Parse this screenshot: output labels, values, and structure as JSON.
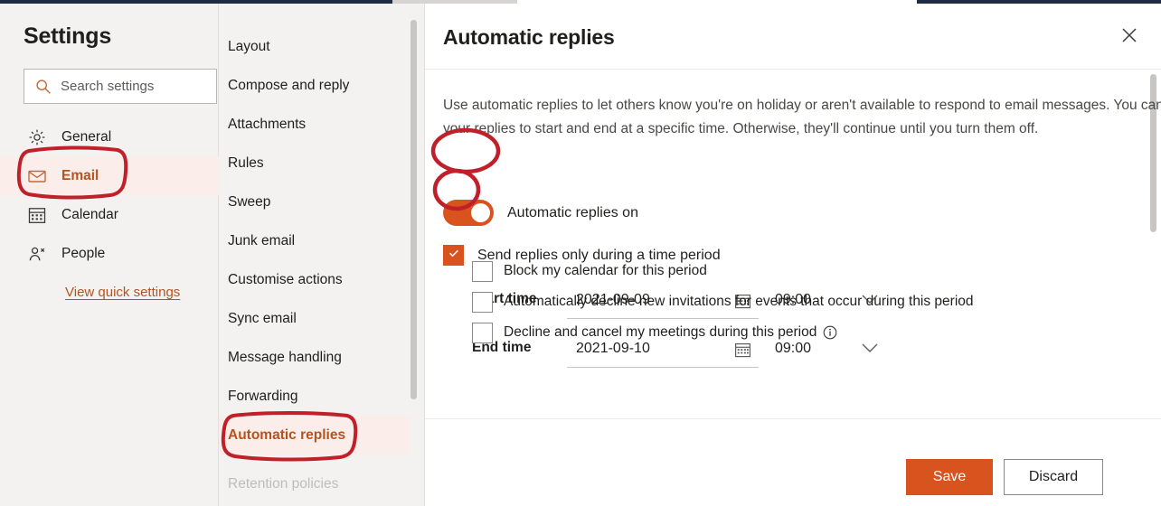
{
  "sidebar": {
    "title": "Settings",
    "search": {
      "placeholder": "Search settings",
      "icon": "search-icon"
    },
    "items": [
      {
        "label": "General",
        "icon": "gear-icon",
        "selected": false
      },
      {
        "label": "Email",
        "icon": "envelope-icon",
        "selected": true
      },
      {
        "label": "Calendar",
        "icon": "calendar-icon",
        "selected": false
      },
      {
        "label": "People",
        "icon": "people-icon",
        "selected": false
      }
    ],
    "quick_link": "View quick settings"
  },
  "subnav": {
    "items": [
      {
        "label": "Layout",
        "selected": false
      },
      {
        "label": "Compose and reply",
        "selected": false
      },
      {
        "label": "Attachments",
        "selected": false
      },
      {
        "label": "Rules",
        "selected": false
      },
      {
        "label": "Sweep",
        "selected": false
      },
      {
        "label": "Junk email",
        "selected": false
      },
      {
        "label": "Customise actions",
        "selected": false
      },
      {
        "label": "Sync email",
        "selected": false
      },
      {
        "label": "Message handling",
        "selected": false
      },
      {
        "label": "Forwarding",
        "selected": false
      },
      {
        "label": "Automatic replies",
        "selected": true
      }
    ],
    "clipped_item": "Retention policies"
  },
  "panel": {
    "title": "Automatic replies",
    "close_icon": "close-icon",
    "description": "Use automatic replies to let others know you're on holiday or aren't available to respond to email messages. You can set your replies to start and end at a specific time. Otherwise, they'll continue until you turn them off.",
    "toggle": {
      "label": "Automatic replies on",
      "on": true
    },
    "time_period_checkbox": {
      "label": "Send replies only during a time period",
      "checked": true
    },
    "time_rows": [
      {
        "key": "Start time",
        "date": "2021-09-09",
        "time": "09:00",
        "date_icon": "calendar-icon",
        "chevron": "chevron-down-icon"
      },
      {
        "key": "End time",
        "date": "2021-09-10",
        "time": "09:00",
        "date_icon": "calendar-icon",
        "chevron": "chevron-down-icon"
      }
    ],
    "options": [
      {
        "label": "Block my calendar for this period",
        "checked": false,
        "info": false
      },
      {
        "label": "Automatically decline new invitations for events that occur during this period",
        "checked": false,
        "info": false
      },
      {
        "label": "Decline and cancel my meetings during this period",
        "checked": false,
        "info": true
      }
    ],
    "footer": {
      "save_label": "Save",
      "discard_label": "Discard"
    }
  },
  "colors": {
    "accent_orange": "#D9531E",
    "selected_bg": "#FBEEEA",
    "selected_text": "#B5531F",
    "annotation_red": "#C0202A",
    "panel_bg": "#FFFFFF",
    "chrome_bg": "#F3F2F1"
  },
  "annotations": [
    {
      "target": "sidebar-item-email",
      "shape": "rounded-rect"
    },
    {
      "target": "subnav-item-automatic-replies",
      "shape": "rounded-rect"
    },
    {
      "target": "automatic-replies-toggle",
      "shape": "ellipse"
    },
    {
      "target": "time-period-checkbox",
      "shape": "ellipse"
    }
  ]
}
